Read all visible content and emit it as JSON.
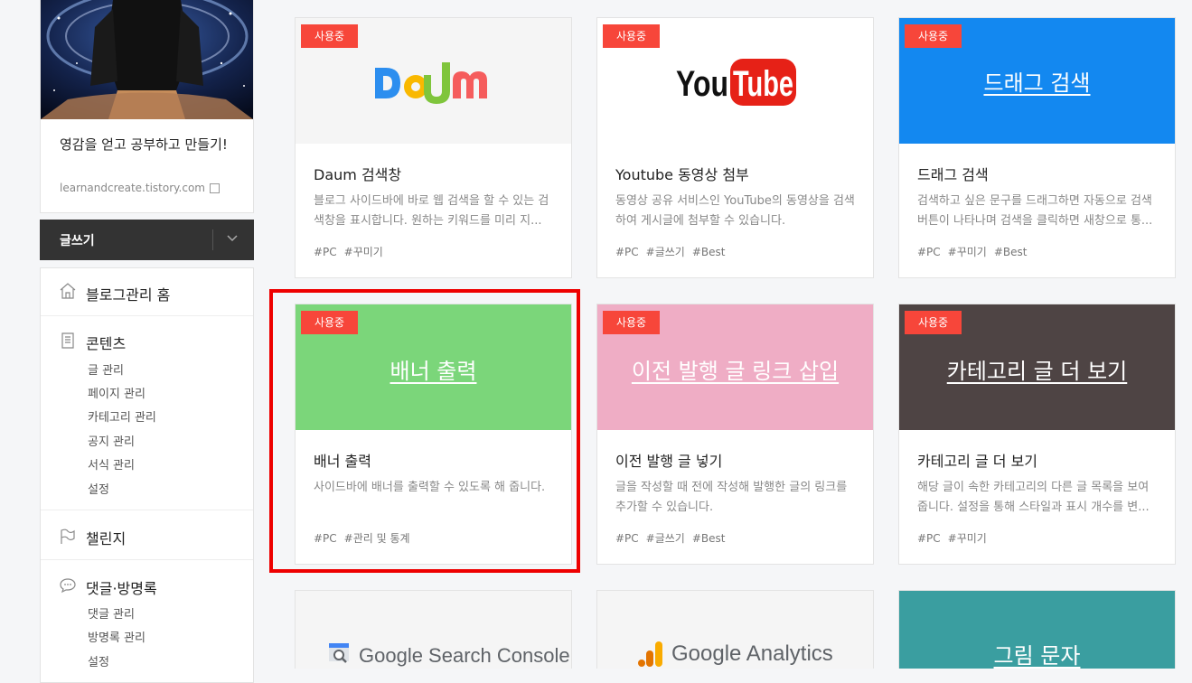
{
  "profile": {
    "title": "영감을 얻고 공부하고 만들기!",
    "url": "learnandcreate.tistory.com"
  },
  "write_button": {
    "label": "글쓰기"
  },
  "nav": {
    "home": "블로그관리 홈",
    "content": {
      "label": "콘텐츠",
      "items": [
        "글 관리",
        "페이지 관리",
        "카테고리 관리",
        "공지 관리",
        "서식 관리",
        "설정"
      ]
    },
    "challenge": "챌린지",
    "comments": {
      "label": "댓글·방명록",
      "items": [
        "댓글 관리",
        "방명록 관리",
        "설정"
      ]
    }
  },
  "badge_label": "사용중",
  "cards": [
    {
      "title": "Daum 검색창",
      "desc": "블로그 사이드바에 바로 웹 검색을 할 수 있는 검색창을 표시합니다. 원하는 키워드를 미리 지...",
      "tags": [
        "#PC",
        "#꾸미기"
      ],
      "thumb_color": "#f5f5f5",
      "thumb_logo": "Daum"
    },
    {
      "title": "Youtube 동영상 첨부",
      "desc": "동영상 공유 서비스인 YouTube의 동영상을 검색하여 게시글에 첨부할 수 있습니다.",
      "tags": [
        "#PC",
        "#글쓰기",
        "#Best"
      ],
      "thumb_color": "#ffffff",
      "thumb_logo": "YouTube"
    },
    {
      "title": "드래그 검색",
      "desc": "검색하고 싶은 문구를 드래그하면 자동으로 검색 버튼이 나타나며 검색을 클릭하면 새창으로 통...",
      "tags": [
        "#PC",
        "#꾸미기",
        "#Best"
      ],
      "thumb_color": "#1388f0",
      "thumb_text": "드래그 검색"
    },
    {
      "title": "배너 출력",
      "desc": "사이드바에 배너를 출력할 수 있도록 해 줍니다.",
      "tags": [
        "#PC",
        "#관리 및 통계"
      ],
      "thumb_color": "#7bd67a",
      "thumb_text": "배너 출력"
    },
    {
      "title": "이전 발행 글 넣기",
      "desc": "글을 작성할 때 전에 작성해 발행한 글의 링크를 추가할 수 있습니다.",
      "tags": [
        "#PC",
        "#글쓰기",
        "#Best"
      ],
      "thumb_color": "#efadc5",
      "thumb_text": "이전 발행 글 링크 삽입"
    },
    {
      "title": "카테고리 글 더 보기",
      "desc": "해당 글이 속한 카테고리의 다른 글 목록을 보여줍니다. 설정을 통해 스타일과 표시 개수를 변...",
      "tags": [
        "#PC",
        "#꾸미기"
      ],
      "thumb_color": "#4e4444",
      "thumb_text": "카테고리 글 더 보기"
    },
    {
      "thumb_color": "#f5f5f5",
      "thumb_logo": "Google Search Console"
    },
    {
      "thumb_color": "#f5f5f5",
      "thumb_logo": "Google Analytics"
    },
    {
      "thumb_color": "#3a9ea0",
      "thumb_text": "그림 문자"
    }
  ]
}
